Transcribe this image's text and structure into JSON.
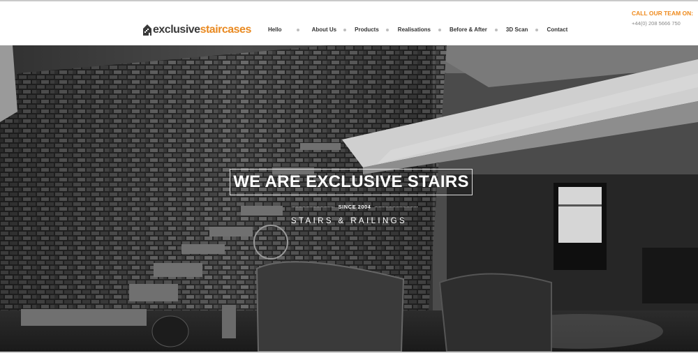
{
  "brand": {
    "name_part1": "exclusive",
    "name_part2": "staircases",
    "colors": {
      "dark": "#3a3a3a",
      "accent": "#e98a22"
    }
  },
  "nav": {
    "items": [
      {
        "label": "Hello"
      },
      {
        "label": "About Us"
      },
      {
        "label": "Products"
      },
      {
        "label": "Realisations"
      },
      {
        "label": "Before & After"
      },
      {
        "label": "3D Scan"
      },
      {
        "label": "Contact"
      }
    ]
  },
  "contact": {
    "call_label": "CALL OUR TEAM ON:",
    "phone": "+44(0) 208 5666 750",
    "accent_color": "#ef8a1c"
  },
  "hero": {
    "title": "WE ARE EXCLUSIVE STAIRS",
    "since": "SINCE 2004",
    "subtitle": "STAIRS & RAILINGS",
    "image_description_icon": "staircase-photo"
  }
}
